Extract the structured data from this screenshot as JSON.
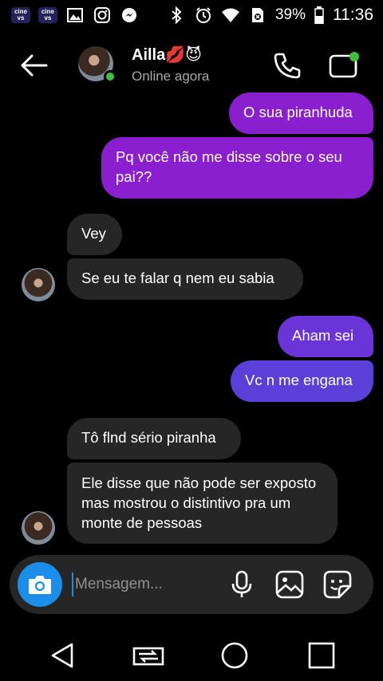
{
  "status_bar": {
    "app_icons": [
      "cine",
      "cine",
      "image-icon",
      "instagram-icon",
      "messenger-icon"
    ],
    "cine_label_top": "cine",
    "cine_label_bottom": "vs",
    "battery_percent": "39%",
    "time": "11:36"
  },
  "header": {
    "name": "Ailla💋😈",
    "status": "Online agora"
  },
  "messages": [
    {
      "dir": "out",
      "text": "O sua piranhuda"
    },
    {
      "dir": "out",
      "text": "Pq você não me disse sobre o seu pai??"
    },
    {
      "dir": "in",
      "text": "Vey"
    },
    {
      "dir": "in",
      "text": "Se eu te falar q nem eu sabia"
    },
    {
      "dir": "out",
      "text": "Aham sei"
    },
    {
      "dir": "out",
      "text": "Vc n me engana"
    },
    {
      "dir": "in",
      "text": "Tô flnd sério piranha"
    },
    {
      "dir": "in",
      "text": "Ele disse que não pode ser exposto mas mostrou o distintivo pra um monte de pessoas"
    }
  ],
  "composer": {
    "placeholder": "Mensagem..."
  },
  "colors": {
    "accent": "#1a8ee8",
    "bubble_in": "#262626",
    "bubble_out_top": "#8a1fd0",
    "bubble_out_bottom": "#5a3fd8",
    "online": "#3ec23e"
  }
}
